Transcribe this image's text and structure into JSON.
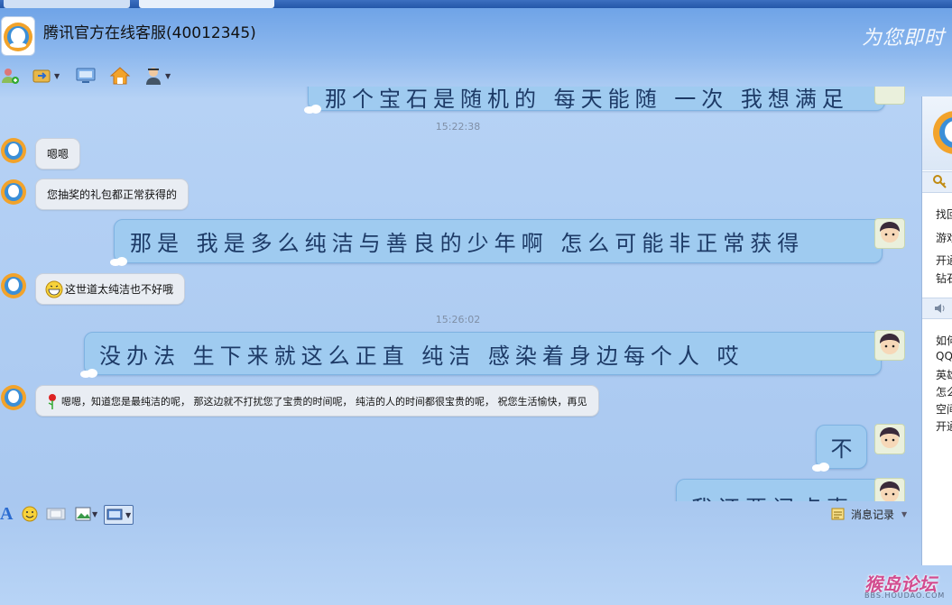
{
  "window": {
    "title": "腾讯官方在线客服(40012345)",
    "slogan": "为您即时"
  },
  "toolbar": {
    "items": [
      "add-friend-icon",
      "file-transfer-icon",
      "remote-assist-icon",
      "qzone-home-icon",
      "security-icon"
    ]
  },
  "chat": {
    "partial_top": "那个宝石是随机的 每天能随 一次 我想满足",
    "messages": [
      {
        "type": "time",
        "text": "15:22:38"
      },
      {
        "type": "received",
        "text": "嗯嗯"
      },
      {
        "type": "received",
        "text": "您抽奖的礼包都正常获得的"
      },
      {
        "type": "sent",
        "text": "那是  我是多么纯洁与善良的少年啊  怎么可能非正常获得"
      },
      {
        "type": "received",
        "text": "这世道太纯洁也不好哦",
        "emoji": "grin-emoji"
      },
      {
        "type": "time",
        "text": "15:26:02"
      },
      {
        "type": "sent",
        "text": "没办法  生下来就这么正直  纯洁   感染着身边每个人  哎"
      },
      {
        "type": "received",
        "text": "嗯嗯，知道您是最纯洁的呢，  那这边就不打扰您了宝贵的时间呢，  纯洁的人的时间都很宝贵的呢，  祝您生活愉快，再见",
        "emoji": "rose-emoji"
      },
      {
        "type": "sent",
        "text": "不"
      },
      {
        "type": "sent",
        "text": "我还要问点事"
      }
    ]
  },
  "input_toolbar": {
    "items": [
      "font-icon",
      "emoticon-icon",
      "screenshot-icon",
      "image-icon",
      "video-icon"
    ],
    "history_label": "消息记录"
  },
  "right_panel": {
    "items_group1": [
      "找回",
      "游戏",
      "开通",
      "钻石"
    ],
    "items_group2": [
      "如何",
      "QQ",
      "英雄",
      "怎么",
      "空间",
      "开通"
    ]
  },
  "watermark": {
    "text": "猴岛论坛",
    "sub": "BBS.HOUDAO.COM"
  },
  "colors": {
    "accent_blue": "#5b97e4",
    "sent_bubble": "#9fcbf0",
    "received_bubble": "#e9edf3"
  }
}
